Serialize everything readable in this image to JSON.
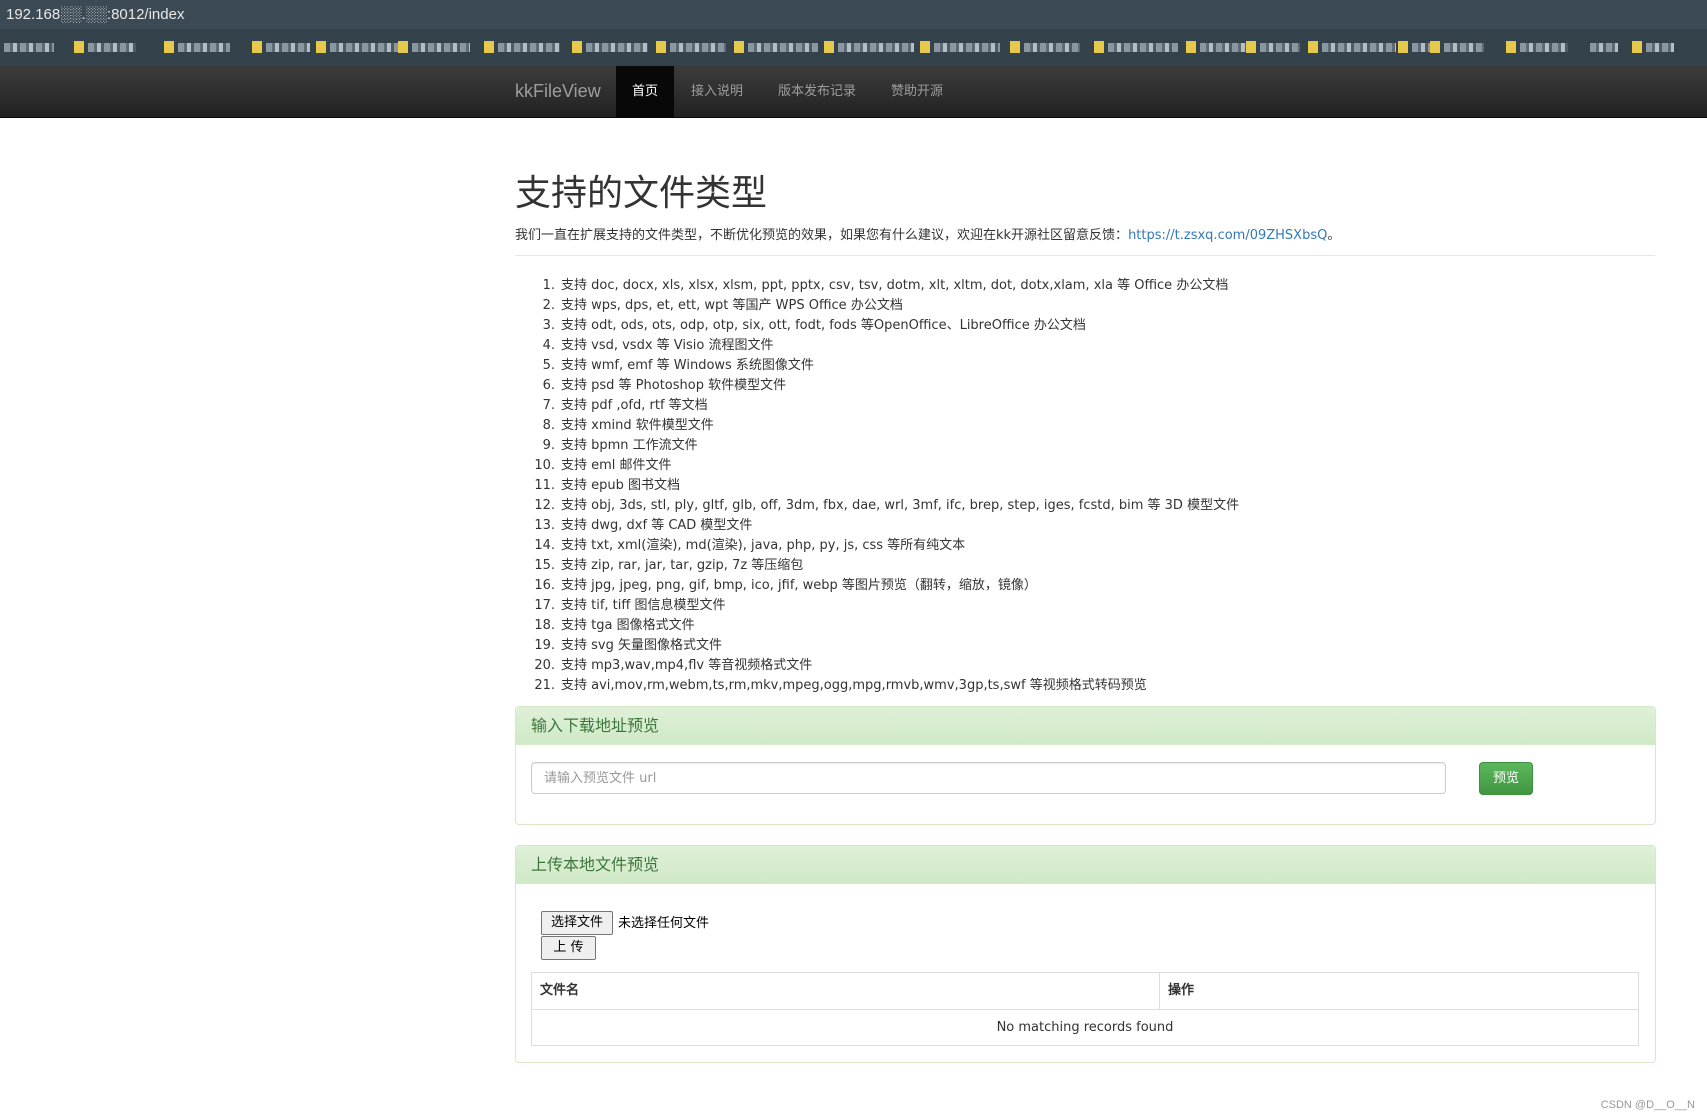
{
  "browser": {
    "address": "192.168░░.░░:8012/index"
  },
  "navbar": {
    "brand": "kkFileView",
    "items": [
      {
        "label": "首页",
        "active": true
      },
      {
        "label": "接入说明",
        "active": false
      },
      {
        "label": "版本发布记录",
        "active": false
      },
      {
        "label": "赞助开源",
        "active": false
      }
    ]
  },
  "main": {
    "title": "支持的文件类型",
    "intro": "我们一直在扩展支持的文件类型，不断优化预览的效果，如果您有什么建议，欢迎在kk开源社区留意反馈：",
    "intro_link": "https://t.zsxq.com/09ZHSXbsQ",
    "intro_suffix": "。",
    "types": [
      "支持 doc, docx, xls, xlsx, xlsm, ppt, pptx, csv, tsv, dotm, xlt, xltm, dot, dotx,xlam, xla 等 Office 办公文档",
      "支持 wps, dps, et, ett, wpt 等国产 WPS Office 办公文档",
      "支持 odt, ods, ots, odp, otp, six, ott, fodt, fods 等OpenOffice、LibreOffice 办公文档",
      "支持 vsd, vsdx 等 Visio 流程图文件",
      "支持 wmf, emf 等 Windows 系统图像文件",
      "支持 psd 等 Photoshop 软件模型文件",
      "支持 pdf ,ofd, rtf 等文档",
      "支持 xmind 软件模型文件",
      "支持 bpmn 工作流文件",
      "支持 eml 邮件文件",
      "支持 epub 图书文档",
      "支持 obj, 3ds, stl, ply, gltf, glb, off, 3dm, fbx, dae, wrl, 3mf, ifc, brep, step, iges, fcstd, bim 等 3D 模型文件",
      "支持 dwg, dxf 等 CAD 模型文件",
      "支持 txt, xml(渲染), md(渲染), java, php, py, js, css 等所有纯文本",
      "支持 zip, rar, jar, tar, gzip, 7z 等压缩包",
      "支持 jpg, jpeg, png, gif, bmp, ico, jfif, webp 等图片预览（翻转，缩放，镜像）",
      "支持 tif, tiff 图信息模型文件",
      "支持 tga 图像格式文件",
      "支持 svg 矢量图像格式文件",
      "支持 mp3,wav,mp4,flv 等音视频格式文件",
      "支持 avi,mov,rm,webm,ts,rm,mkv,mpeg,ogg,mpg,rmvb,wmv,3gp,ts,swf 等视频格式转码预览"
    ]
  },
  "url_panel": {
    "heading": "输入下载地址预览",
    "placeholder": "请输入预览文件 url",
    "button": "预览"
  },
  "upload_panel": {
    "heading": "上传本地文件预览",
    "choose_button": "选择文件",
    "no_file": "未选择任何文件",
    "upload_button": "上 传",
    "table": {
      "columns": [
        "文件名",
        "操作"
      ],
      "empty": "No matching records found"
    }
  },
  "watermark": "CSDN @D__O__N"
}
